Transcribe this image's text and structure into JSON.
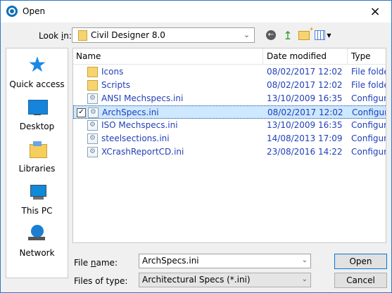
{
  "window": {
    "title": "Open",
    "close_symbol": "×"
  },
  "toolbar": {
    "look_in_label_prefix": "Look ",
    "look_in_label_hotkey": "i",
    "look_in_label_suffix": "n:",
    "look_in_value": "Civil Designer 8.0",
    "icons": [
      "folder-icon",
      "back-icon",
      "up-folder-icon",
      "new-folder-icon",
      "view-menu-icon"
    ]
  },
  "places": [
    {
      "label": "Quick access",
      "icon": "quick-access-icon"
    },
    {
      "label": "Desktop",
      "icon": "desktop-icon"
    },
    {
      "label": "Libraries",
      "icon": "libraries-icon"
    },
    {
      "label": "This PC",
      "icon": "this-pc-icon"
    },
    {
      "label": "Network",
      "icon": "network-icon"
    }
  ],
  "file_list": {
    "columns": [
      "Name",
      "Date modified",
      "Type"
    ],
    "rows": [
      {
        "name": "Icons",
        "date": "08/02/2017 12:02",
        "type": "File folder",
        "icon": "folder-icon",
        "selected": false
      },
      {
        "name": "Scripts",
        "date": "08/02/2017 12:02",
        "type": "File folder",
        "icon": "folder-icon",
        "selected": false
      },
      {
        "name": "ANSI Mechspecs.ini",
        "date": "13/10/2009 16:35",
        "type": "Configura",
        "icon": "ini-file-icon",
        "selected": false
      },
      {
        "name": "ArchSpecs.ini",
        "date": "08/02/2017 12:02",
        "type": "Configura",
        "icon": "ini-file-icon",
        "selected": true
      },
      {
        "name": "ISO Mechspecs.ini",
        "date": "13/10/2009 16:35",
        "type": "Configura",
        "icon": "ini-file-icon",
        "selected": false
      },
      {
        "name": "steelsections.ini",
        "date": "14/08/2013 17:09",
        "type": "Configura",
        "icon": "ini-file-icon",
        "selected": false
      },
      {
        "name": "XCrashReportCD.ini",
        "date": "23/08/2016 14:22",
        "type": "Configura",
        "icon": "ini-file-icon",
        "selected": false
      }
    ]
  },
  "form": {
    "file_name_label_prefix": "File ",
    "file_name_label_hotkey": "n",
    "file_name_label_suffix": "ame:",
    "file_name_value": "ArchSpecs.ini",
    "file_type_label": "Files of type:",
    "file_type_value": "Architectural Specs (*.ini)"
  },
  "buttons": {
    "open": "Open",
    "cancel": "Cancel"
  },
  "colors": {
    "link_blue": "#1f3fb8",
    "selection": "#cde8ff",
    "folder": "#f7d46f"
  }
}
